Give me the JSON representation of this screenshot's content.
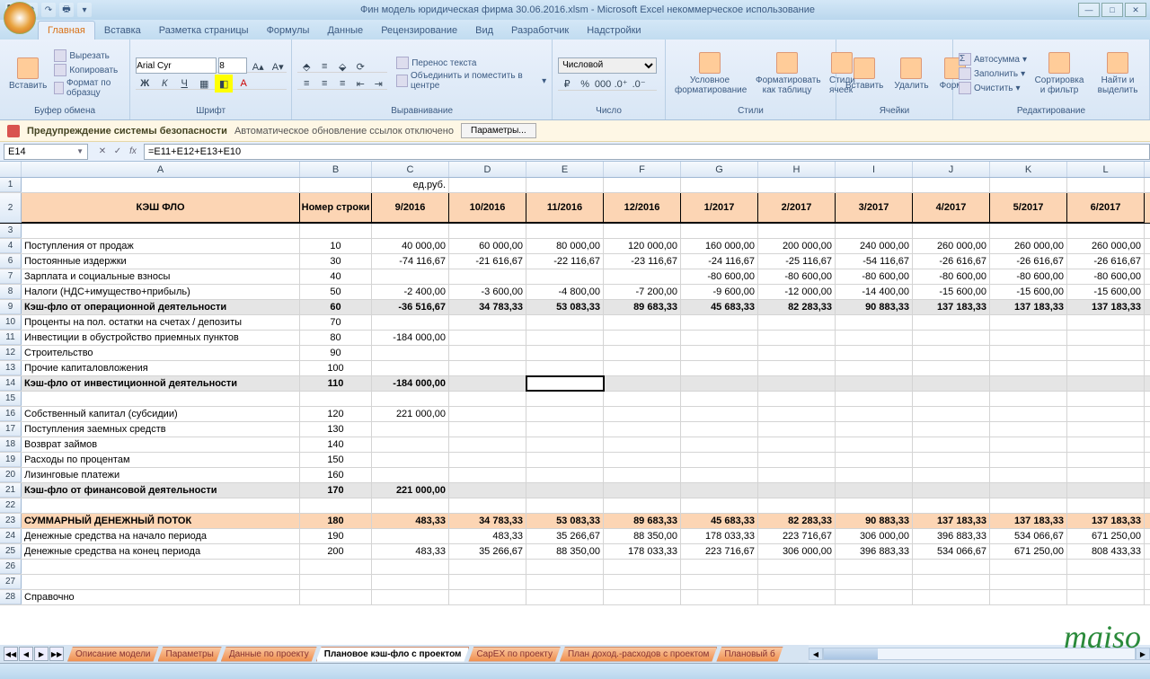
{
  "title": "Фин модель юридическая фирма 30.06.2016.xlsm - Microsoft Excel некоммерческое использование",
  "ribbon_tabs": [
    "Главная",
    "Вставка",
    "Разметка страницы",
    "Формулы",
    "Данные",
    "Рецензирование",
    "Вид",
    "Разработчик",
    "Надстройки"
  ],
  "active_tab": 0,
  "clipboard": {
    "paste": "Вставить",
    "cut": "Вырезать",
    "copy": "Копировать",
    "fmt": "Формат по образцу",
    "label": "Буфер обмена"
  },
  "font": {
    "name": "Arial Cyr",
    "size": "8",
    "label": "Шрифт"
  },
  "align": {
    "wrap": "Перенос текста",
    "merge": "Объединить и поместить в центре",
    "label": "Выравнивание"
  },
  "number": {
    "fmt": "Числовой",
    "label": "Число"
  },
  "styles": {
    "cond": "Условное форматирование",
    "table": "Форматировать как таблицу",
    "cell": "Стили ячеек",
    "label": "Стили"
  },
  "cells": {
    "ins": "Вставить",
    "del": "Удалить",
    "fmt": "Формат",
    "label": "Ячейки"
  },
  "editing": {
    "sum": "Автосумма",
    "fill": "Заполнить",
    "clear": "Очистить",
    "sort": "Сортировка и фильтр",
    "find": "Найти и выделить",
    "label": "Редактирование"
  },
  "security": {
    "title": "Предупреждение системы безопасности",
    "msg": "Автоматическое обновление ссылок отключено",
    "btn": "Параметры..."
  },
  "namebox": "E14",
  "formula": "=E11+E12+E13+E10",
  "cols": [
    "A",
    "B",
    "C",
    "D",
    "E",
    "F",
    "G",
    "H",
    "I",
    "J",
    "K",
    "L"
  ],
  "unit": "ед.руб.",
  "header_row": [
    "КЭШ ФЛО",
    "Номер строки",
    "9/2016",
    "10/2016",
    "11/2016",
    "12/2016",
    "1/2017",
    "2/2017",
    "3/2017",
    "4/2017",
    "5/2017",
    "6/2017"
  ],
  "rows": [
    {
      "n": "1",
      "cells": [
        "",
        "",
        "ед.руб.",
        "",
        "",
        "",
        "",
        "",
        "",
        "",
        "",
        ""
      ]
    },
    {
      "n": "2",
      "cls": "peach hdr",
      "cells": [
        "КЭШ ФЛО",
        "Номер строки",
        "9/2016",
        "10/2016",
        "11/2016",
        "12/2016",
        "1/2017",
        "2/2017",
        "3/2017",
        "4/2017",
        "5/2017",
        "6/2017"
      ]
    },
    {
      "n": "3",
      "cells": [
        "",
        "",
        "",
        "",
        "",
        "",
        "",
        "",
        "",
        "",
        "",
        ""
      ]
    },
    {
      "n": "4",
      "cells": [
        "Поступления от продаж",
        "10",
        "40 000,00",
        "60 000,00",
        "80 000,00",
        "120 000,00",
        "160 000,00",
        "200 000,00",
        "240 000,00",
        "260 000,00",
        "260 000,00",
        "260 000,00"
      ]
    },
    {
      "n": "6",
      "cells": [
        "Постоянные издержки",
        "30",
        "-74 116,67",
        "-21 616,67",
        "-22 116,67",
        "-23 116,67",
        "-24 116,67",
        "-25 116,67",
        "-54 116,67",
        "-26 616,67",
        "-26 616,67",
        "-26 616,67"
      ]
    },
    {
      "n": "7",
      "cells": [
        "Зарплата и социальные взносы",
        "40",
        "",
        "",
        "",
        "",
        "-80 600,00",
        "-80 600,00",
        "-80 600,00",
        "-80 600,00",
        "-80 600,00",
        "-80 600,00"
      ]
    },
    {
      "n": "8",
      "cells": [
        "Налоги (НДС+имущество+прибыль)",
        "50",
        "-2 400,00",
        "-3 600,00",
        "-4 800,00",
        "-7 200,00",
        "-9 600,00",
        "-12 000,00",
        "-14 400,00",
        "-15 600,00",
        "-15 600,00",
        "-15 600,00"
      ]
    },
    {
      "n": "9",
      "cls": "grey",
      "cells": [
        "Кэш-фло от операционной деятельности",
        "60",
        "-36 516,67",
        "34 783,33",
        "53 083,33",
        "89 683,33",
        "45 683,33",
        "82 283,33",
        "90 883,33",
        "137 183,33",
        "137 183,33",
        "137 183,33"
      ]
    },
    {
      "n": "10",
      "cells": [
        "Проценты на пол. остатки на счетах / депозиты",
        "70",
        "",
        "",
        "",
        "",
        "",
        "",
        "",
        "",
        "",
        ""
      ]
    },
    {
      "n": "11",
      "cells": [
        "Инвестиции в обустройство приемных пунктов",
        "80",
        "-184 000,00",
        "",
        "",
        "",
        "",
        "",
        "",
        "",
        "",
        ""
      ]
    },
    {
      "n": "12",
      "cells": [
        "Строительство",
        "90",
        "",
        "",
        "",
        "",
        "",
        "",
        "",
        "",
        "",
        ""
      ]
    },
    {
      "n": "13",
      "cells": [
        "Прочие капиталовложения",
        "100",
        "",
        "",
        "",
        "",
        "",
        "",
        "",
        "",
        "",
        ""
      ]
    },
    {
      "n": "14",
      "cls": "grey",
      "sel": 4,
      "cells": [
        "Кэш-фло от инвестиционной деятельности",
        "110",
        "-184 000,00",
        "",
        "",
        "",
        "",
        "",
        "",
        "",
        "",
        ""
      ]
    },
    {
      "n": "15",
      "cells": [
        "",
        "",
        "",
        "",
        "",
        "",
        "",
        "",
        "",
        "",
        "",
        ""
      ]
    },
    {
      "n": "16",
      "cells": [
        "Собственный капитал (субсидии)",
        "120",
        "221 000,00",
        "",
        "",
        "",
        "",
        "",
        "",
        "",
        "",
        ""
      ]
    },
    {
      "n": "17",
      "cells": [
        "Поступления заемных средств",
        "130",
        "",
        "",
        "",
        "",
        "",
        "",
        "",
        "",
        "",
        ""
      ]
    },
    {
      "n": "18",
      "cells": [
        "Возврат займов",
        "140",
        "",
        "",
        "",
        "",
        "",
        "",
        "",
        "",
        "",
        ""
      ]
    },
    {
      "n": "19",
      "cells": [
        "Расходы по процентам",
        "150",
        "",
        "",
        "",
        "",
        "",
        "",
        "",
        "",
        "",
        ""
      ]
    },
    {
      "n": "20",
      "cells": [
        "Лизинговые платежи",
        "160",
        "",
        "",
        "",
        "",
        "",
        "",
        "",
        "",
        "",
        ""
      ]
    },
    {
      "n": "21",
      "cls": "grey",
      "cells": [
        "Кэш-фло от финансовой деятельности",
        "170",
        "221 000,00",
        "",
        "",
        "",
        "",
        "",
        "",
        "",
        "",
        ""
      ]
    },
    {
      "n": "22",
      "cells": [
        "",
        "",
        "",
        "",
        "",
        "",
        "",
        "",
        "",
        "",
        "",
        ""
      ]
    },
    {
      "n": "23",
      "cls": "peach",
      "cells": [
        "СУММАРНЫЙ ДЕНЕЖНЫЙ ПОТОК",
        "180",
        "483,33",
        "34 783,33",
        "53 083,33",
        "89 683,33",
        "45 683,33",
        "82 283,33",
        "90 883,33",
        "137 183,33",
        "137 183,33",
        "137 183,33"
      ]
    },
    {
      "n": "24",
      "cells": [
        "Денежные средства на начало периода",
        "190",
        "",
        "483,33",
        "35 266,67",
        "88 350,00",
        "178 033,33",
        "223 716,67",
        "306 000,00",
        "396 883,33",
        "534 066,67",
        "671 250,00"
      ]
    },
    {
      "n": "25",
      "cells": [
        "Денежные средства на конец периода",
        "200",
        "483,33",
        "35 266,67",
        "88 350,00",
        "178 033,33",
        "223 716,67",
        "306 000,00",
        "396 883,33",
        "534 066,67",
        "671 250,00",
        "808 433,33"
      ]
    },
    {
      "n": "26",
      "cells": [
        "",
        "",
        "",
        "",
        "",
        "",
        "",
        "",
        "",
        "",
        "",
        ""
      ]
    },
    {
      "n": "27",
      "cells": [
        "",
        "",
        "",
        "",
        "",
        "",
        "",
        "",
        "",
        "",
        "",
        ""
      ]
    },
    {
      "n": "28",
      "cells": [
        "Справочно",
        "",
        "",
        "",
        "",
        "",
        "",
        "",
        "",
        "",
        "",
        ""
      ]
    }
  ],
  "sheets": [
    {
      "name": "Описание модели"
    },
    {
      "name": "Параметры"
    },
    {
      "name": "Данные по проекту"
    },
    {
      "name": "Плановое кэш-фло с проектом",
      "active": true
    },
    {
      "name": "CapEX по проекту"
    },
    {
      "name": "План доход.-расходов с проектом"
    },
    {
      "name": "Плановый б"
    }
  ],
  "watermark": "maiso"
}
